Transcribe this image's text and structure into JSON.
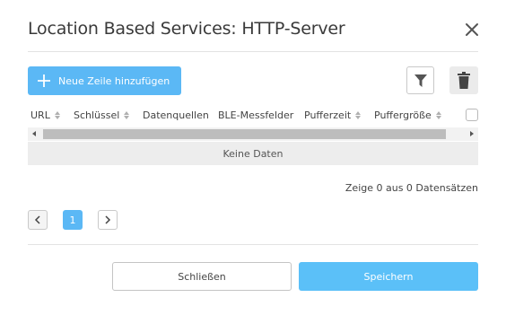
{
  "dialog": {
    "title": "Location Based Services: HTTP-Server"
  },
  "toolbar": {
    "add_row_label": "Neue Zeile hinzufügen"
  },
  "table": {
    "columns": [
      "URL",
      "Schlüssel",
      "Datenquellen",
      "BLE-Messfelder",
      "Pufferzeit",
      "Puffergröße"
    ],
    "empty_text": "Keine Daten",
    "info": "Zeige 0 aus 0 Datensätzen"
  },
  "pagination": {
    "current_page": "1"
  },
  "footer": {
    "close_label": "Schließen",
    "save_label": "Speichern"
  },
  "colors": {
    "accent": "#5bb8f5",
    "scrollbar_thumb": "#bdbdbd",
    "empty_row_bg": "#ededed"
  },
  "icons": {
    "close": "close-icon",
    "add": "plus-icon",
    "filter": "filter-icon",
    "delete": "trash-icon",
    "prev": "chevron-left-icon",
    "next": "chevron-right-icon"
  }
}
